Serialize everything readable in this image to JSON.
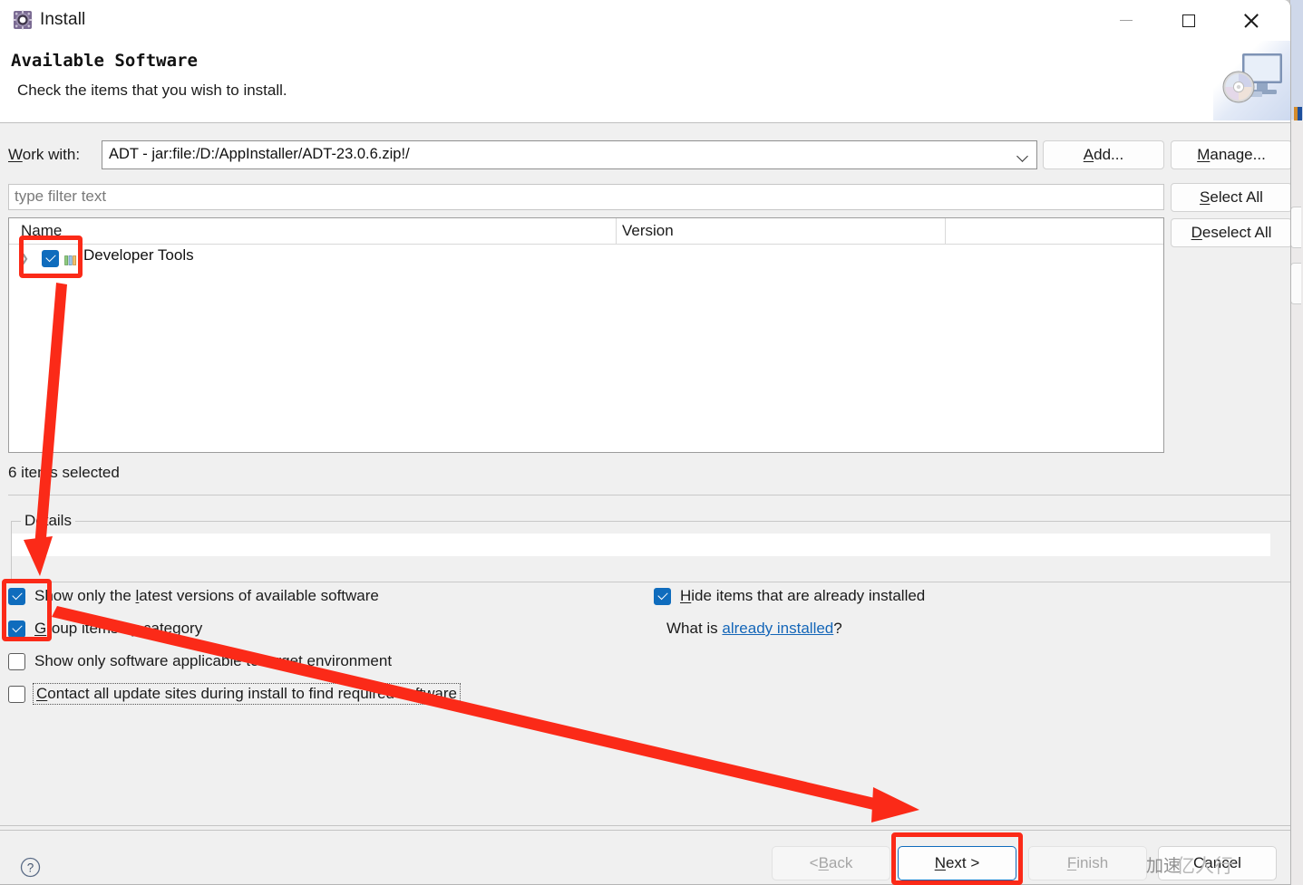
{
  "window": {
    "title": "Install",
    "icon": "install-gear-icon",
    "controls": {
      "minimize": "minimize-icon",
      "maximize": "maximize-icon",
      "close": "close-icon"
    }
  },
  "header": {
    "title": "Available Software",
    "subtitle": "Check the items that you wish to install.",
    "banner_icon": "monitor-with-disc-icon"
  },
  "work_with": {
    "label": "Work with:",
    "label_mnemonic": "W",
    "value": "ADT - jar:file:/D:/AppInstaller/ADT-23.0.6.zip!/",
    "dropdown_icon": "chevron-down-icon"
  },
  "buttons": {
    "add": "Add...",
    "manage": "Manage...",
    "select_all": "Select All",
    "deselect_all": "Deselect All"
  },
  "filter": {
    "placeholder": "type filter text",
    "value": ""
  },
  "tree": {
    "columns": [
      "Name",
      "Version"
    ],
    "rows": [
      {
        "label": "Developer Tools",
        "version": "",
        "checked": true,
        "expandable": true,
        "expand_icon": "chevron-right-icon",
        "item_icon": "feature-bars-icon"
      }
    ]
  },
  "status": {
    "items_selected": "6 items selected"
  },
  "details": {
    "group_label": "Details",
    "content": ""
  },
  "options": [
    {
      "label": "Show only the latest versions of available software",
      "checked": true,
      "mnemonic": "l",
      "focused": false
    },
    {
      "label": "Group items by category",
      "checked": true,
      "mnemonic": "G",
      "focused": false
    },
    {
      "label": "Show only software applicable to target environment",
      "checked": false,
      "mnemonic": "",
      "focused": false
    },
    {
      "label": "Contact all update sites during install to find required software",
      "checked": false,
      "mnemonic": "C",
      "focused": true
    }
  ],
  "options_right": {
    "hide_installed": {
      "label": "Hide items that are already installed",
      "checked": true,
      "mnemonic": "H"
    },
    "what_is_prefix": "What is ",
    "what_is_link": "already installed",
    "what_is_suffix": "?"
  },
  "footer": {
    "help_icon": "help-question-icon",
    "back": "< Back",
    "next": "Next >",
    "finish": "Finish",
    "cancel": "Cancel",
    "back_disabled": true,
    "next_disabled": false,
    "finish_disabled": true,
    "cancel_disabled": false
  },
  "watermark": {
    "text": "亿人行",
    "overlay": "加速"
  },
  "annotations": {
    "color": "#fb2a18",
    "boxes": [
      "tree-checkbox",
      "option-checkboxes",
      "next-button"
    ],
    "arrows": [
      "checkbox-to-options",
      "options-to-next"
    ]
  }
}
